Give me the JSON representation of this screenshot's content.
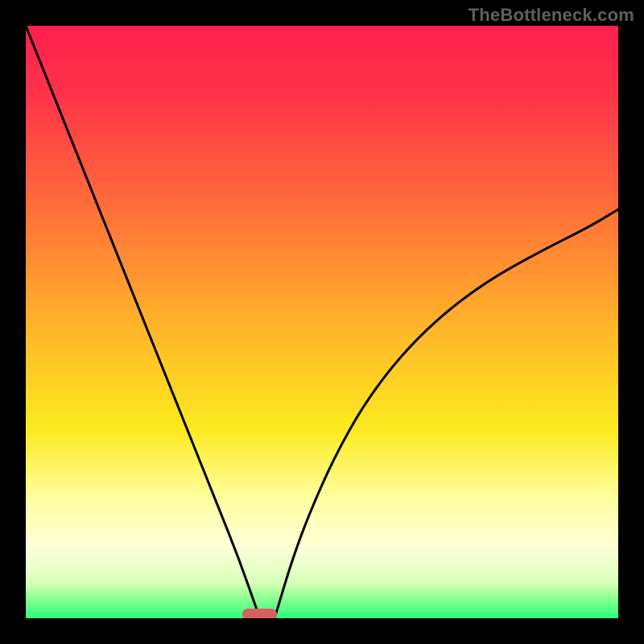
{
  "watermark": "TheBottleneck.com",
  "marker": {
    "name": "bottleneck-indicator",
    "x_frac": 0.395,
    "width_frac": 0.058
  },
  "chart_data": {
    "type": "line",
    "title": "",
    "xlabel": "",
    "ylabel": "",
    "xlim": [
      0,
      1
    ],
    "ylim": [
      0,
      1
    ],
    "background": {
      "type": "vertical-gradient",
      "stops": [
        {
          "pos": 0.0,
          "color": "#ff1f4e"
        },
        {
          "pos": 0.12,
          "color": "#ff3449"
        },
        {
          "pos": 0.3,
          "color": "#ff6c3a"
        },
        {
          "pos": 0.5,
          "color": "#ffb22a"
        },
        {
          "pos": 0.68,
          "color": "#fcea1e"
        },
        {
          "pos": 0.8,
          "color": "#feffa0"
        },
        {
          "pos": 0.88,
          "color": "#fdffd8"
        },
        {
          "pos": 0.94,
          "color": "#d7ffb8"
        },
        {
          "pos": 0.96,
          "color": "#9eff98"
        },
        {
          "pos": 1.0,
          "color": "#2bff79"
        }
      ]
    },
    "series": [
      {
        "name": "left-branch",
        "x": [
          0.0,
          0.04,
          0.08,
          0.12,
          0.16,
          0.2,
          0.24,
          0.28,
          0.32,
          0.36,
          0.395
        ],
        "y": [
          1.0,
          0.9,
          0.8,
          0.7,
          0.6,
          0.5,
          0.4,
          0.3,
          0.2,
          0.1,
          0.0
        ]
      },
      {
        "name": "right-branch",
        "x": [
          0.42,
          0.45,
          0.48,
          0.52,
          0.57,
          0.63,
          0.7,
          0.78,
          0.87,
          0.95,
          1.0
        ],
        "y": [
          0.0,
          0.1,
          0.18,
          0.27,
          0.36,
          0.44,
          0.51,
          0.57,
          0.62,
          0.66,
          0.69
        ]
      }
    ]
  }
}
